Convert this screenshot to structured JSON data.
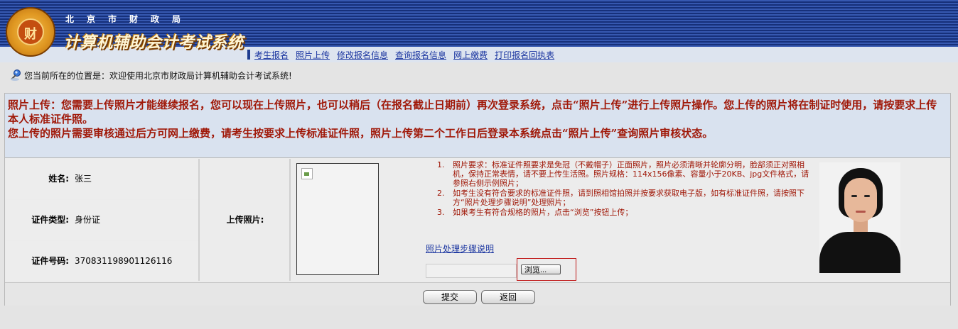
{
  "header": {
    "org": "北京市财政局",
    "system_title": "计算机辅助会计考试系统",
    "logo_glyph": "财"
  },
  "nav": {
    "items": [
      {
        "label": "考生报名"
      },
      {
        "label": "照片上传"
      },
      {
        "label": "修改报名信息"
      },
      {
        "label": "查询报名信息"
      },
      {
        "label": "网上缴费"
      },
      {
        "label": "打印报名回执表"
      }
    ]
  },
  "breadcrumb": {
    "text": "您当前所在的位置是：欢迎使用北京市财政局计算机辅助会计考试系统!"
  },
  "notice": {
    "line1": "照片上传：您需要上传照片才能继续报名，您可以现在上传照片，也可以稍后（在报名截止日期前）再次登录系统，点击“照片上传”进行上传照片操作。您上传的照片将在制证时使用，请按要求上传本人标准证件照。",
    "line2": "您上传的照片需要审核通过后方可网上缴费，请考生按要求上传标准证件照，照片上传第二个工作日后登录本系统点击“照片上传”查询照片审核状态。"
  },
  "info": {
    "name_label": "姓名:",
    "name_value": "张三",
    "id_type_label": "证件类型:",
    "id_type_value": "身份证",
    "id_number_label": "证件号码:",
    "id_number_value": "370831198901126116"
  },
  "upload": {
    "label": "上传照片:",
    "requirements": [
      {
        "num": "1.",
        "text": "照片要求：标准证件照要求是免冠（不戴帽子）正面照片，照片必须清晰并轮廓分明，脸部须正对照相机，保持正常表情，请不要上传生活照。照片规格：114x156像素、容量小于20KB、jpg文件格式，请参照右侧示例照片；"
      },
      {
        "num": "2.",
        "text": "如考生没有符合要求的标准证件照，请到照相馆拍照并按要求获取电子版，如有标准证件照，请按照下方“照片处理步骤说明”处理照片；"
      },
      {
        "num": "3.",
        "text": "如果考生有符合规格的照片，点击“浏览”按钮上传；"
      }
    ],
    "help_link": "照片处理步骤说明",
    "browse_label": "浏览..."
  },
  "buttons": {
    "submit": "提交",
    "back": "返回"
  },
  "colors": {
    "header_blue": "#1e3c8e",
    "notice_red": "#a01808",
    "link_blue": "#1a35a0",
    "highlight_border": "#c01818"
  }
}
